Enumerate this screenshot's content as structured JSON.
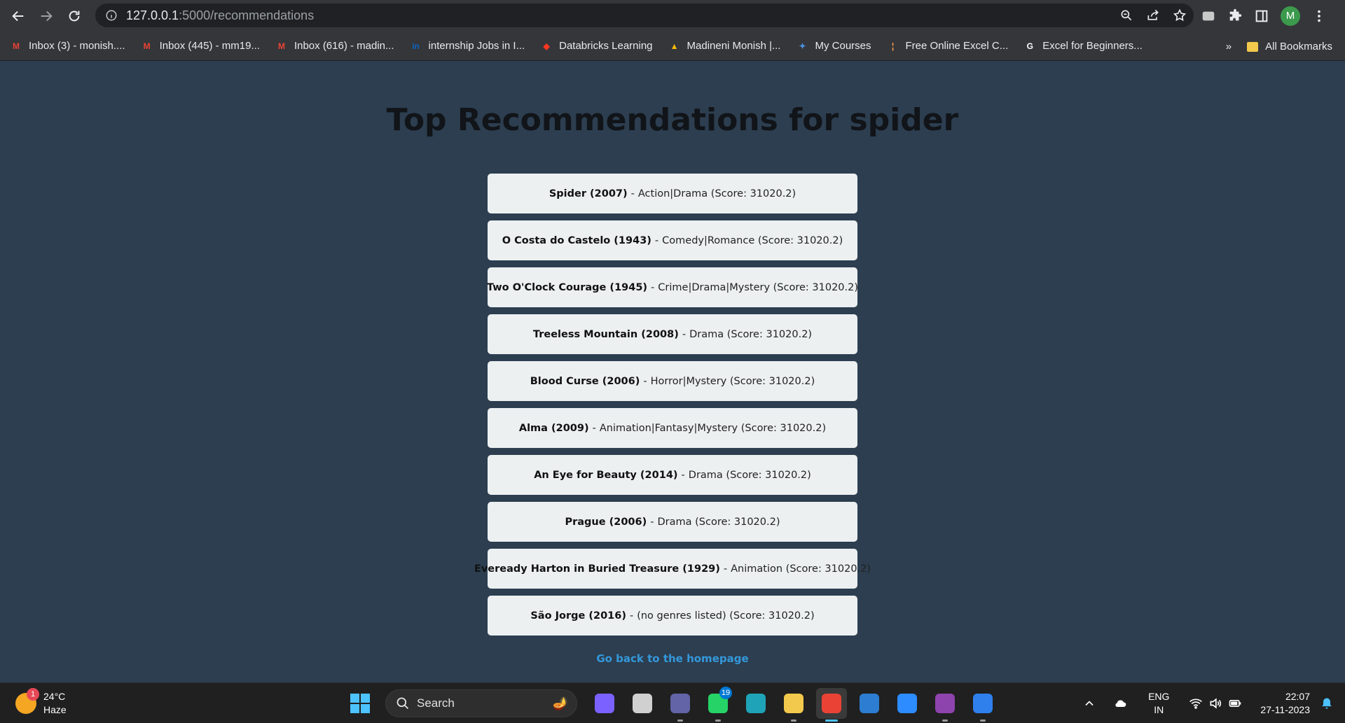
{
  "browser": {
    "url_host": "127.0.0.1",
    "url_path": ":5000/recommendations",
    "avatar_letter": "M",
    "bookmarks": [
      {
        "label": "Inbox (3) - monish....",
        "icon": "gmail-icon",
        "icon_glyph": "M",
        "color": "#ea4335"
      },
      {
        "label": "Inbox (445) - mm19...",
        "icon": "gmail-icon",
        "icon_glyph": "M",
        "color": "#ea4335"
      },
      {
        "label": "Inbox (616) - madin...",
        "icon": "gmail-icon",
        "icon_glyph": "M",
        "color": "#ea4335"
      },
      {
        "label": "internship Jobs in I...",
        "icon": "linkedin-icon",
        "icon_glyph": "in",
        "color": "#0a66c2"
      },
      {
        "label": "Databricks Learning",
        "icon": "databricks-icon",
        "icon_glyph": "◆",
        "color": "#ff3621"
      },
      {
        "label": "Madineni Monish |...",
        "icon": "google-drive-icon",
        "icon_glyph": "▲",
        "color": "#fbbc04"
      },
      {
        "label": "My Courses",
        "icon": "courses-icon",
        "icon_glyph": "✦",
        "color": "#4a90e2"
      },
      {
        "label": "Free Online Excel C...",
        "icon": "excel-course-icon",
        "icon_glyph": "¦",
        "color": "#f2994a"
      },
      {
        "label": "Excel for Beginners...",
        "icon": "google-icon",
        "icon_glyph": "G",
        "color": "#ffffff"
      }
    ],
    "overflow_label": "»",
    "all_bookmarks": "All Bookmarks"
  },
  "page": {
    "title": "Top Recommendations for spider",
    "back_link": "Go back to the homepage",
    "recommendations": [
      {
        "title": "Spider (2007)",
        "sep": "-",
        "detail": "Action|Drama (Score: 31020.2)"
      },
      {
        "title": "O Costa do Castelo (1943)",
        "sep": "-",
        "detail": "Comedy|Romance (Score: 31020.2)"
      },
      {
        "title": "Two O'Clock Courage (1945)",
        "sep": "-",
        "detail": "Crime|Drama|Mystery (Score: 31020.2)"
      },
      {
        "title": "Treeless Mountain (2008)",
        "sep": "-",
        "detail": "Drama (Score: 31020.2)"
      },
      {
        "title": "Blood Curse (2006)",
        "sep": "-",
        "detail": "Horror|Mystery (Score: 31020.2)"
      },
      {
        "title": "Alma (2009)",
        "sep": "-",
        "detail": "Animation|Fantasy|Mystery (Score: 31020.2)"
      },
      {
        "title": "An Eye for Beauty (2014)",
        "sep": "-",
        "detail": "Drama (Score: 31020.2)"
      },
      {
        "title": "Prague (2006)",
        "sep": "-",
        "detail": "Drama (Score: 31020.2)"
      },
      {
        "title": "Eveready Harton in Buried Treasure (1929)",
        "sep": "-",
        "detail": "Animation (Score: 31020.2)"
      },
      {
        "title": "São Jorge (2016)",
        "sep": "-",
        "detail": "(no genres listed) (Score: 31020.2)"
      }
    ]
  },
  "taskbar": {
    "weather_badge": "1",
    "temperature": "24°C",
    "condition": "Haze",
    "search_label": "Search",
    "whatsapp_count": "19",
    "lang_top": "ENG",
    "lang_bottom": "IN",
    "time": "22:07",
    "date": "27-11-2023",
    "apps": [
      {
        "name": "copilot-app-icon",
        "color": "#7b61ff"
      },
      {
        "name": "task-view-icon",
        "color": "#d0d0d0"
      },
      {
        "name": "teams-chat-icon",
        "color": "#6264a7"
      },
      {
        "name": "whatsapp-icon",
        "color": "#25d366"
      },
      {
        "name": "edge-icon",
        "color": "#1fa3b8"
      },
      {
        "name": "file-explorer-icon",
        "color": "#f2c94c"
      },
      {
        "name": "chrome-icon",
        "color": "#ea4335"
      },
      {
        "name": "mail-icon",
        "color": "#2d7dd2"
      },
      {
        "name": "zoom-icon",
        "color": "#2d8cff"
      },
      {
        "name": "github-desktop-icon",
        "color": "#8e44ad"
      },
      {
        "name": "vscode-icon",
        "color": "#2f80ed"
      }
    ]
  }
}
